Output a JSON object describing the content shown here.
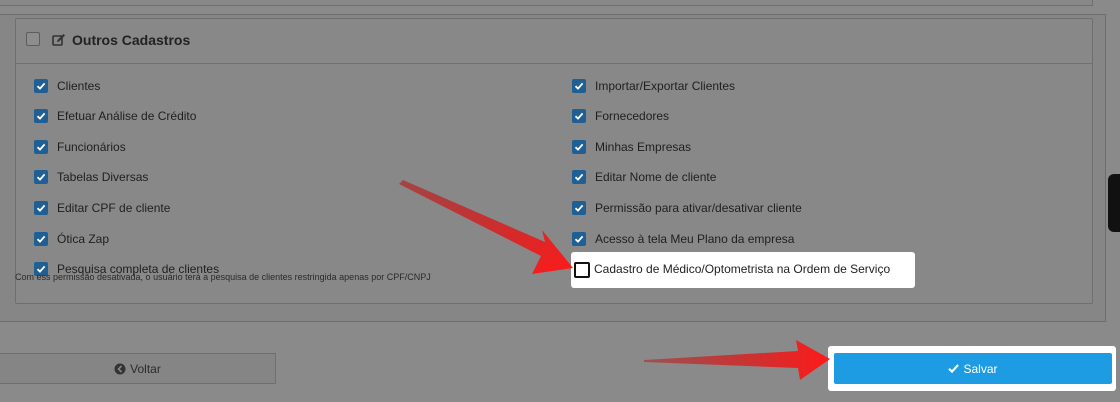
{
  "section": {
    "title": "Outros Cadastros",
    "header_icon": "edit-icon",
    "select_all_checked": false
  },
  "permissions": {
    "left": [
      {
        "label": "Clientes",
        "checked": true
      },
      {
        "label": "Efetuar Análise de Crédito",
        "checked": true
      },
      {
        "label": "Funcionários",
        "checked": true
      },
      {
        "label": "Tabelas Diversas",
        "checked": true
      },
      {
        "label": "Editar CPF de cliente",
        "checked": true
      },
      {
        "label": "Ótica Zap",
        "checked": true
      },
      {
        "label": "Pesquisa completa de clientes",
        "checked": true
      }
    ],
    "right": [
      {
        "label": "Importar/Exportar Clientes",
        "checked": true
      },
      {
        "label": "Fornecedores",
        "checked": true
      },
      {
        "label": "Minhas Empresas",
        "checked": true
      },
      {
        "label": "Editar Nome de cliente",
        "checked": true
      },
      {
        "label": "Permissão para ativar/desativar cliente",
        "checked": true
      },
      {
        "label": "Acesso à tela Meu Plano da empresa",
        "checked": true
      },
      {
        "label": "Cadastro de Médico/Optometrista na Ordem de Serviço",
        "checked": false
      }
    ]
  },
  "note": "Com ess permissão desativada, o usuário terá a pesquisa de clientes restringida apenas por CPF/CNPJ",
  "buttons": {
    "back_label": "Voltar",
    "back_icon": "arrow-circle-left-icon",
    "save_label": "Salvar",
    "save_icon": "check-icon"
  },
  "colors": {
    "checkbox_checked": "#1f5f94",
    "save_button": "#1d9ce3",
    "annotation_arrow": "#e02020"
  }
}
